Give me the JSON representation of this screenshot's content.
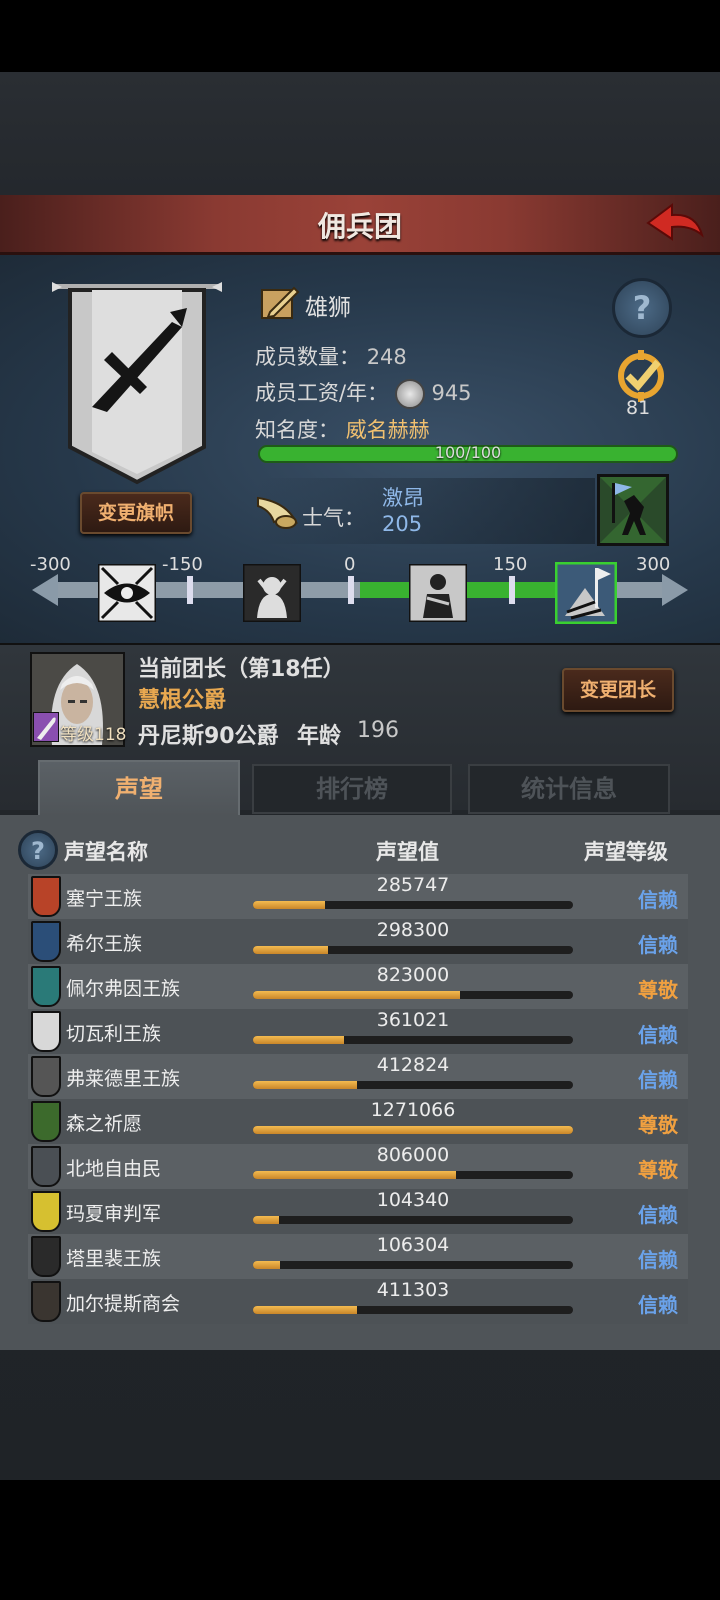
{
  "header": {
    "title": "佣兵团"
  },
  "company": {
    "name": "雄狮",
    "members_label": "成员数量：",
    "members": "248",
    "wage_label": "成员工资/年：",
    "wage": "945",
    "fame_label": "知名度：",
    "fame_value": "威名赫赫",
    "fame_progress": "100/100",
    "fame_fraction": 1.0,
    "change_banner": "变更旗帜",
    "badge_count": "81"
  },
  "morale": {
    "label": "士气：",
    "state": "激昂",
    "value": "205",
    "ticks": [
      "-300",
      "-150",
      "0",
      "150",
      "300"
    ],
    "level": 205
  },
  "leader": {
    "title": "当前团长（第18任）",
    "rank": "慧根公爵",
    "level_label": "等级118",
    "name": "丹尼斯90公爵",
    "age_label": "年龄",
    "age": "196",
    "change_leader": "变更团长"
  },
  "tabs": [
    "声望",
    "排行榜",
    "统计信息"
  ],
  "table": {
    "headers": [
      "声望名称",
      "声望值",
      "声望等级"
    ],
    "max_value": 1271066,
    "rows": [
      {
        "name": "塞宁王族",
        "value": "285747",
        "level": "信赖",
        "color": "#b84328"
      },
      {
        "name": "希尔王族",
        "value": "298300",
        "level": "信赖",
        "color": "#2b4e78"
      },
      {
        "name": "佩尔弗因王族",
        "value": "823000",
        "level": "尊敬",
        "color": "#2a7a78"
      },
      {
        "name": "切瓦利王族",
        "value": "361021",
        "level": "信赖",
        "color": "#d8d8d8"
      },
      {
        "name": "弗莱德里王族",
        "value": "412824",
        "level": "信赖",
        "color": "#555555"
      },
      {
        "name": "森之祈愿",
        "value": "1271066",
        "level": "尊敬",
        "color": "#3c6a2c"
      },
      {
        "name": "北地自由民",
        "value": "806000",
        "level": "尊敬",
        "color": "#4a4f54"
      },
      {
        "name": "玛夏审判军",
        "value": "104340",
        "level": "信赖",
        "color": "#d6c030"
      },
      {
        "name": "塔里裴王族",
        "value": "106304",
        "level": "信赖",
        "color": "#2a2a2a"
      },
      {
        "name": "加尔提斯商会",
        "value": "411303",
        "level": "信赖",
        "color": "#3a3530"
      }
    ]
  },
  "colors": {
    "trust": "#6aa2ea",
    "respect": "#f0a040",
    "morale_green": "#39b230"
  }
}
